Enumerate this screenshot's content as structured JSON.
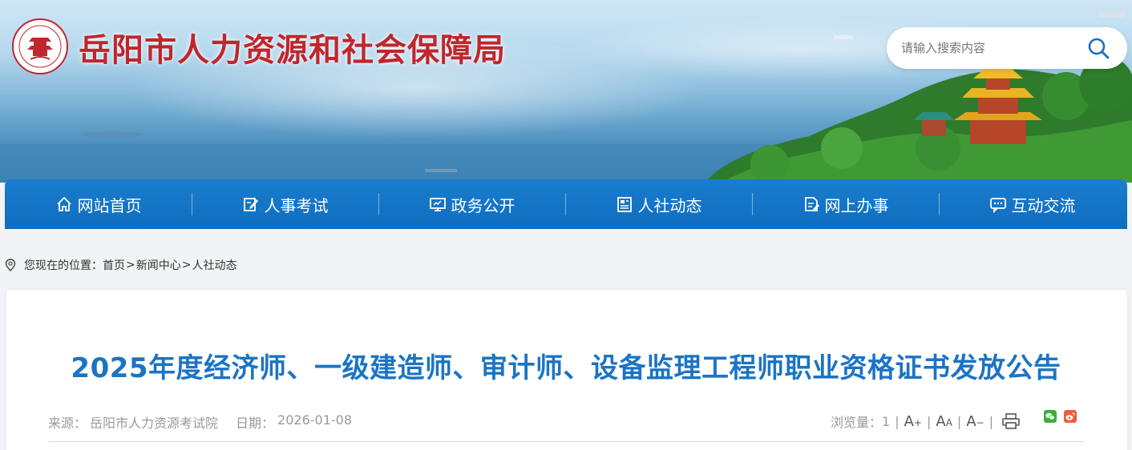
{
  "header": {
    "site_title": "岳阳市人力资源和社会保障局",
    "logo_icon": "government-seal-icon",
    "search_placeholder": "请输入搜索内容",
    "search_icon": "search-icon"
  },
  "nav": {
    "items": [
      {
        "label": "网站首页",
        "icon": "home-icon"
      },
      {
        "label": "人事考试",
        "icon": "edit-icon"
      },
      {
        "label": "政务公开",
        "icon": "monitor-icon"
      },
      {
        "label": "人社动态",
        "icon": "news-icon"
      },
      {
        "label": "网上办事",
        "icon": "document-icon"
      },
      {
        "label": "互动交流",
        "icon": "chat-icon"
      }
    ]
  },
  "breadcrumb": {
    "label": "您现在的位置：",
    "items": [
      "首页",
      "新闻中心",
      "人社动态"
    ],
    "separator": ">"
  },
  "article": {
    "title": "2025年度经济师、一级建造师、审计师、设备监理工程师职业资格证书发放公告",
    "source_label": "来源：",
    "source": "岳阳市人力资源考试院",
    "date_label": "日期：",
    "date": "2026-01-08",
    "views_label": "浏览量：",
    "views": "1",
    "separator": "|",
    "font_increase": "A",
    "font_reset": "A",
    "font_decrease": "A"
  },
  "colors": {
    "nav_blue": "#1a7dce",
    "title_red": "#c0262d",
    "article_title_blue": "#1b74c4",
    "wechat_green": "#3cb034",
    "weibo_red": "#e8603c"
  }
}
